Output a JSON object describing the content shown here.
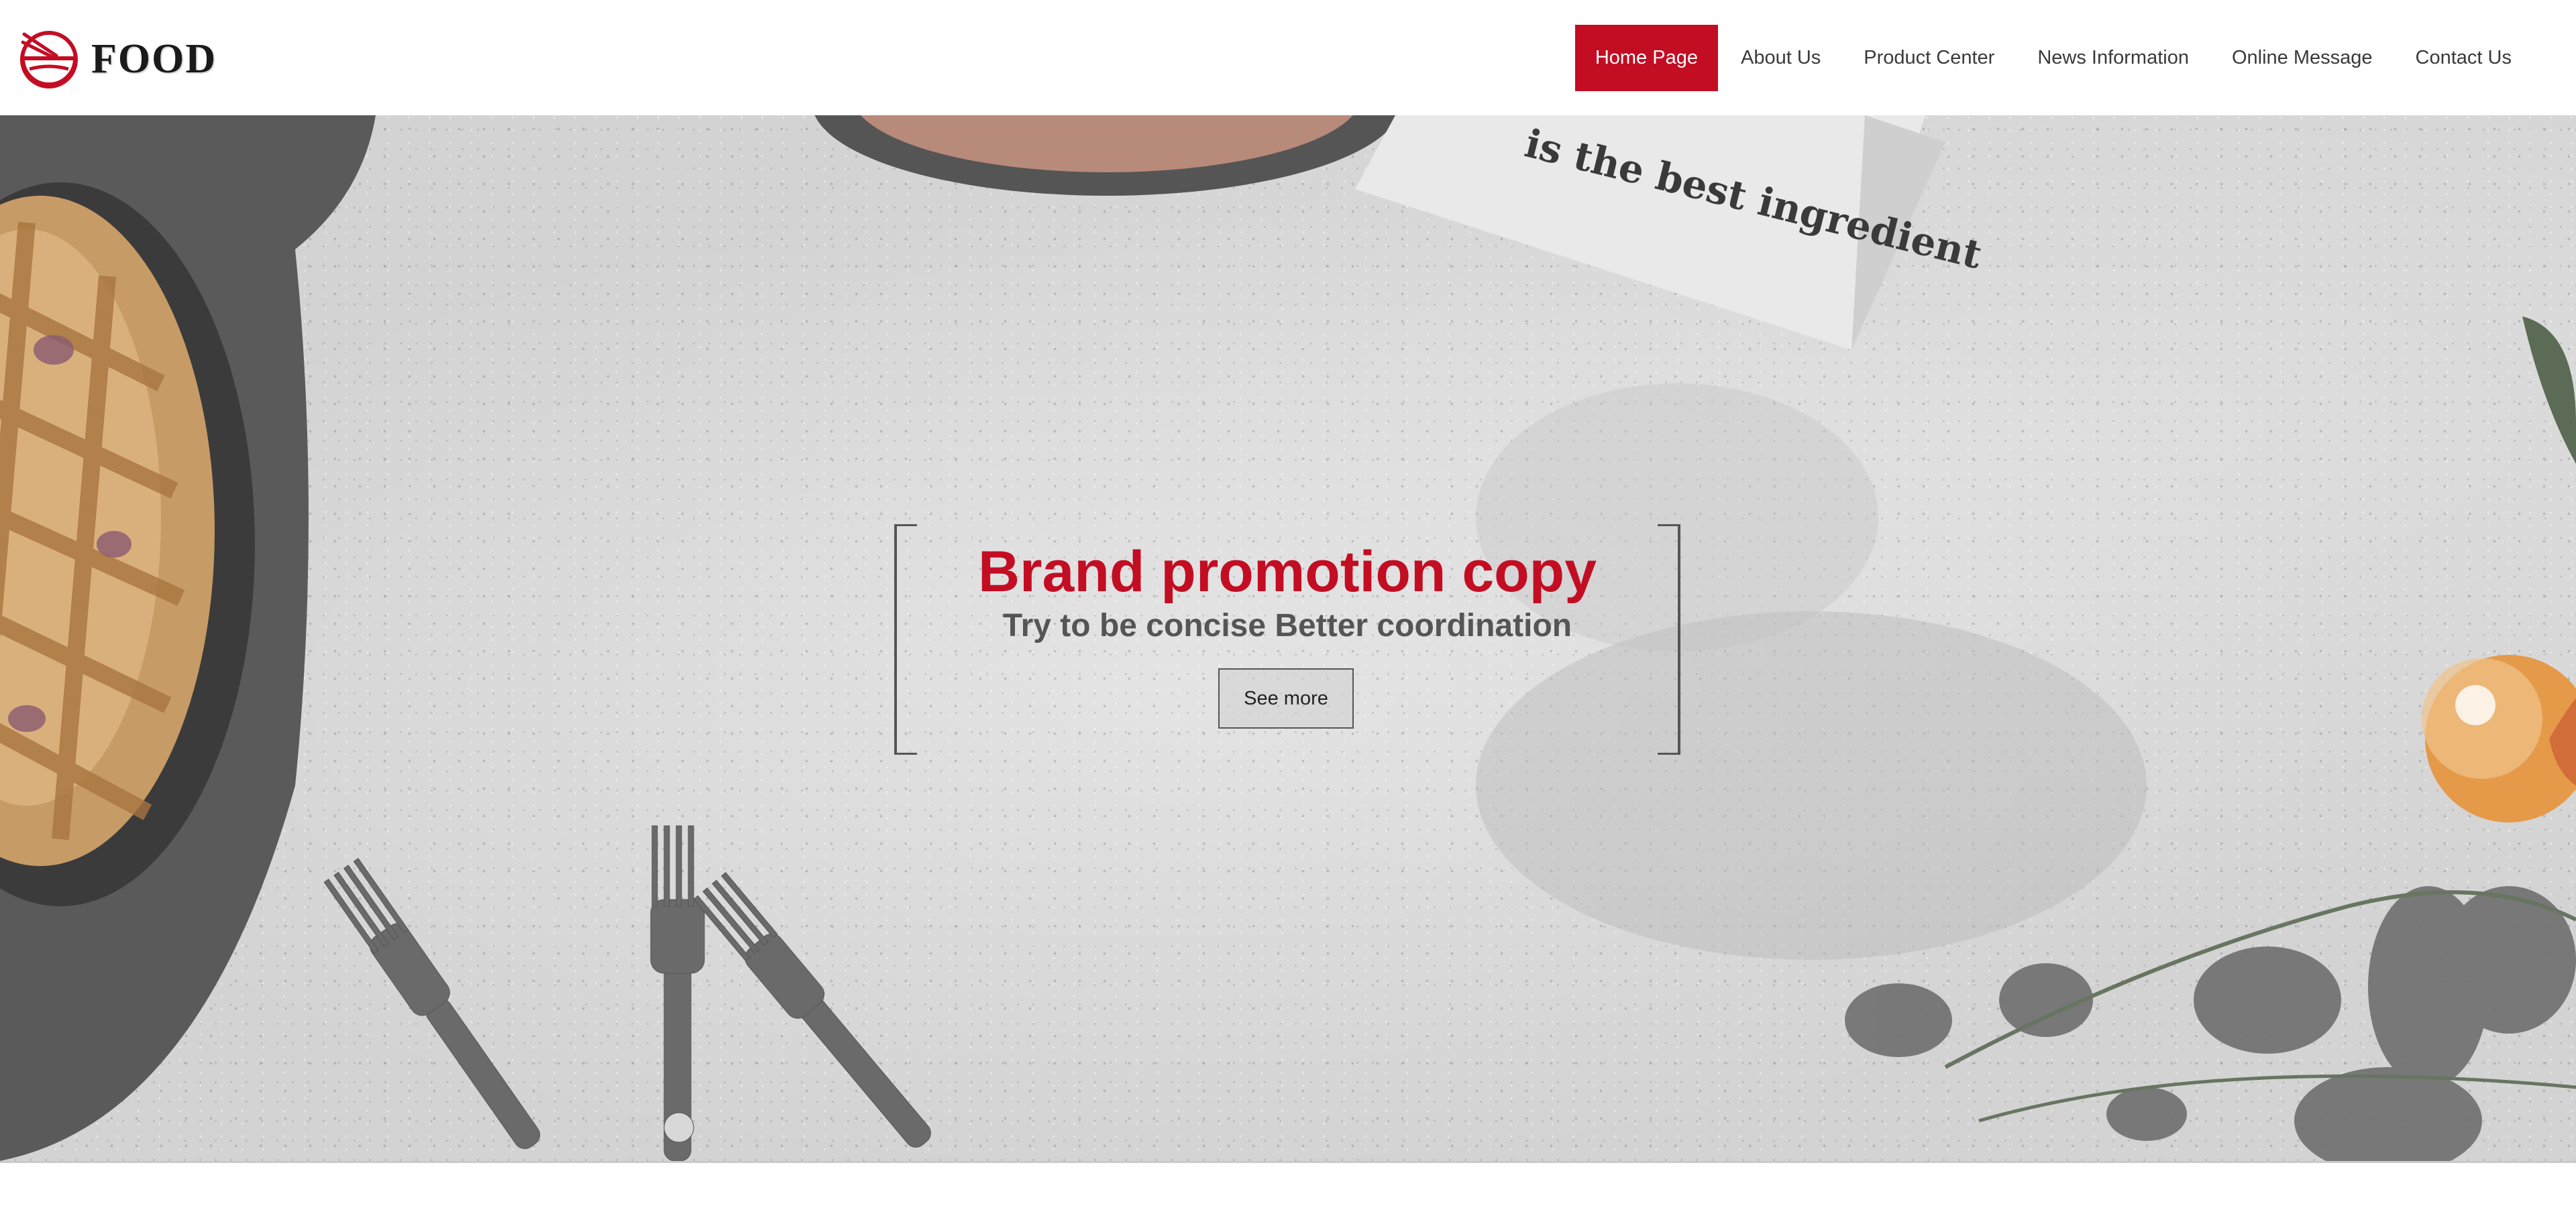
{
  "brand": {
    "name": "FOOD",
    "icon": "bowl-chopsticks-icon",
    "accent_color": "#c30d23"
  },
  "nav": {
    "items": [
      {
        "label": "Home Page",
        "active": true
      },
      {
        "label": "About Us",
        "active": false
      },
      {
        "label": "Product Center",
        "active": false
      },
      {
        "label": "News Information",
        "active": false
      },
      {
        "label": "Online Message",
        "active": false
      },
      {
        "label": "Contact Us",
        "active": false
      }
    ]
  },
  "hero": {
    "background": "grey-table-food-photo",
    "napkin_text": "is the best ingredient",
    "title": "Brand promotion copy",
    "subtitle": "Try to be concise Better coordination",
    "button_label": "See more"
  }
}
